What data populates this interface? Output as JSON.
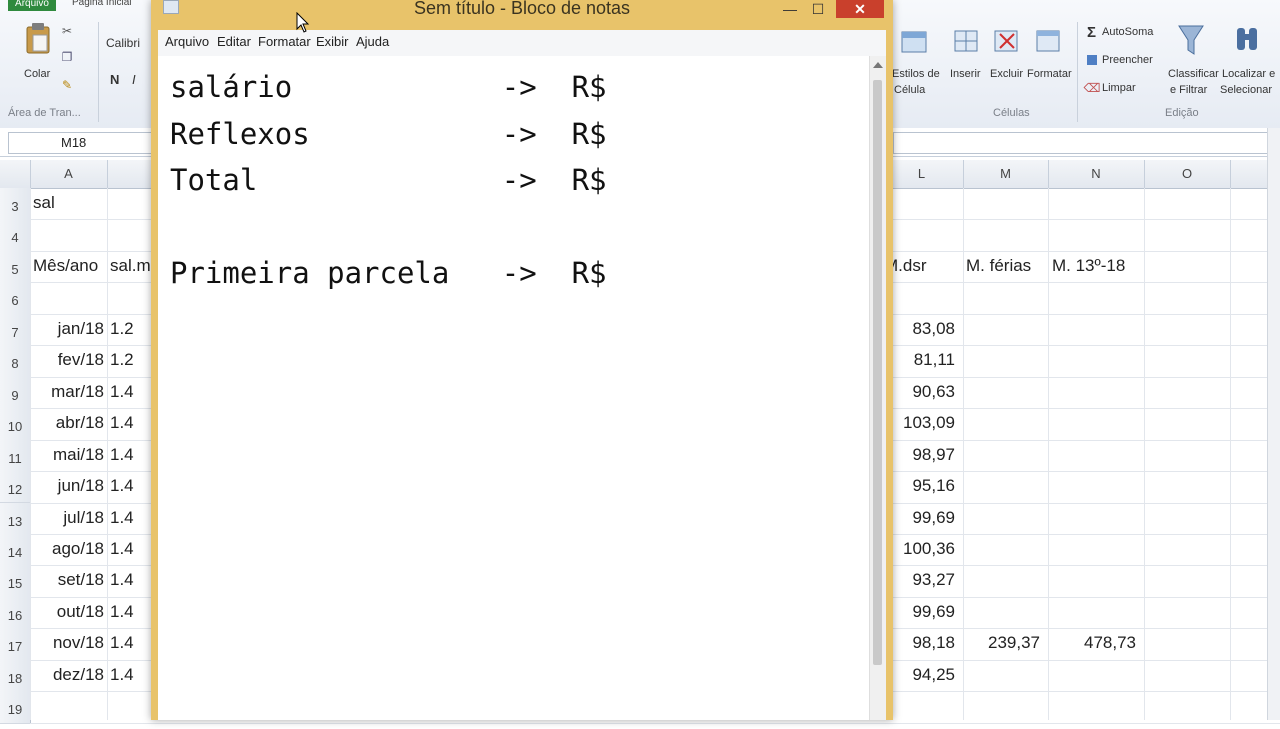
{
  "excel": {
    "ribbon": {
      "tab_file": "Arquivo",
      "tab_home": "Página Inicial",
      "font_name": "Calibri",
      "paste_label": "Colar",
      "bold": "N",
      "italic": "I",
      "clipboard_group": "Área de Tran...",
      "styles_label_1": "Estilos de",
      "styles_label_2": "Célula",
      "insert_label": "Inserir",
      "delete_label": "Excluir",
      "format_label": "Formatar",
      "cells_group": "Células",
      "autosum": "AutoSoma",
      "fill": "Preencher",
      "clear": "Limpar",
      "sort_1": "Classificar",
      "sort_2": "e Filtrar",
      "find_1": "Localizar e",
      "find_2": "Selecionar",
      "editing_group": "Edição"
    },
    "name_box": "M18",
    "columns_left": [
      "A"
    ],
    "columns_right": [
      "L",
      "M",
      "N",
      "O"
    ],
    "rows": [
      {
        "n": "3",
        "a": "sal",
        "b": "",
        "l": "",
        "m": "",
        "nn": ""
      },
      {
        "n": "4",
        "a": "",
        "b": "",
        "l": "",
        "m": "",
        "nn": ""
      },
      {
        "n": "5",
        "a": "Mês/ano",
        "b": "sal.m",
        "l": "M.dsr",
        "m": "M. férias",
        "nn": "M. 13º-18"
      },
      {
        "n": "6",
        "a": "",
        "b": "",
        "l": "",
        "m": "",
        "nn": ""
      },
      {
        "n": "7",
        "a": "jan/18",
        "b": "1.2",
        "l": "83,08",
        "m": "",
        "nn": ""
      },
      {
        "n": "8",
        "a": "fev/18",
        "b": "1.2",
        "l": "81,11",
        "m": "",
        "nn": ""
      },
      {
        "n": "9",
        "a": "mar/18",
        "b": "1.4",
        "l": "90,63",
        "m": "",
        "nn": ""
      },
      {
        "n": "10",
        "a": "abr/18",
        "b": "1.4",
        "l": "103,09",
        "m": "",
        "nn": ""
      },
      {
        "n": "11",
        "a": "mai/18",
        "b": "1.4",
        "l": "98,97",
        "m": "",
        "nn": ""
      },
      {
        "n": "12",
        "a": "jun/18",
        "b": "1.4",
        "l": "95,16",
        "m": "",
        "nn": ""
      },
      {
        "n": "13",
        "a": "jul/18",
        "b": "1.4",
        "l": "99,69",
        "m": "",
        "nn": ""
      },
      {
        "n": "14",
        "a": "ago/18",
        "b": "1.4",
        "l": "100,36",
        "m": "",
        "nn": ""
      },
      {
        "n": "15",
        "a": "set/18",
        "b": "1.4",
        "l": "93,27",
        "m": "",
        "nn": ""
      },
      {
        "n": "16",
        "a": "out/18",
        "b": "1.4",
        "l": "99,69",
        "m": "",
        "nn": ""
      },
      {
        "n": "17",
        "a": "nov/18",
        "b": "1.4",
        "l": "98,18",
        "m": "239,37",
        "nn": "478,73"
      },
      {
        "n": "18",
        "a": "dez/18",
        "b": "1.4",
        "l": "94,25",
        "m": "",
        "nn": ""
      },
      {
        "n": "19",
        "a": "",
        "b": "",
        "l": "",
        "m": "",
        "nn": ""
      }
    ]
  },
  "notepad": {
    "title": "Sem título - Bloco de notas",
    "menu": [
      "Arquivo",
      "Editar",
      "Formatar",
      "Exibir",
      "Ajuda"
    ],
    "content": "salário            ->  R$\nReflexos           ->  R$\nTotal              ->  R$\n\nPrimeira parcela   ->  R$"
  },
  "colors": {
    "notepad_frame": "#e8c36a",
    "close_button": "#c9402c",
    "excel_file_tab": "#2f8a3e"
  }
}
